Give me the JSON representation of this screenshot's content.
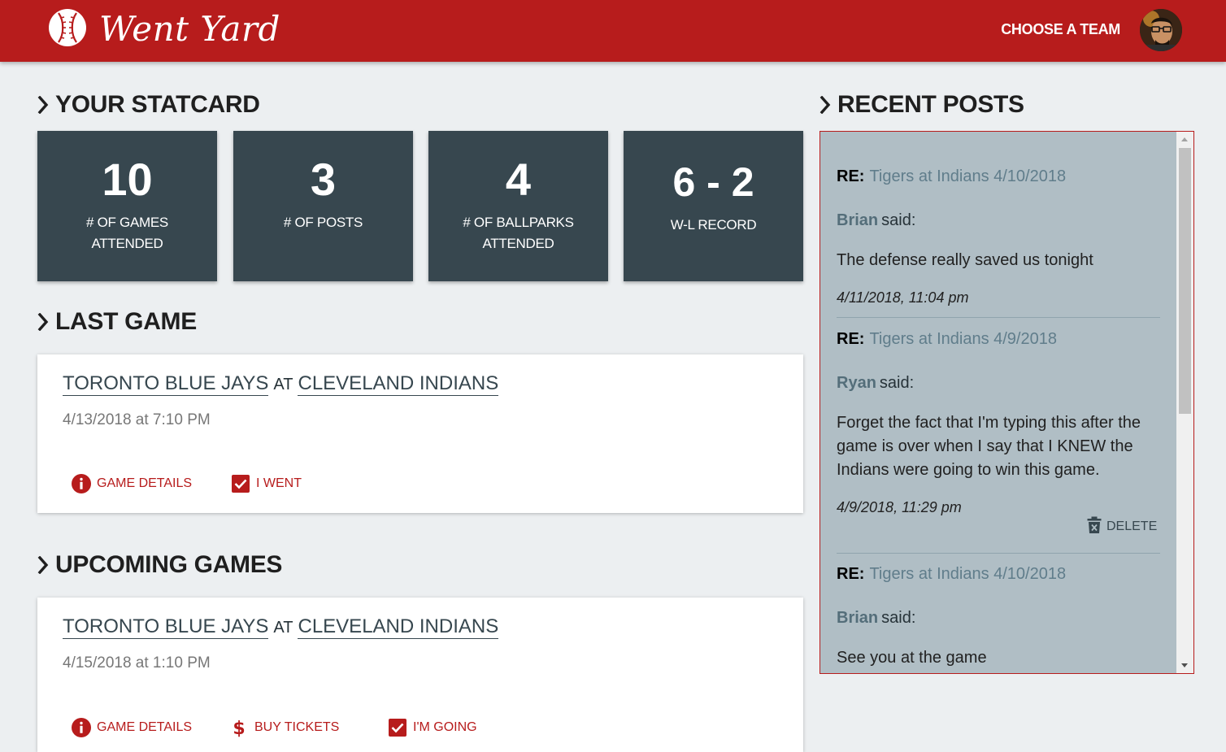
{
  "header": {
    "brand": "Went Yard",
    "nav_choose_team": "CHOOSE A TEAM",
    "brand_color": "#b71c1c"
  },
  "sections": {
    "statcard": "YOUR STATCARD",
    "last_game": "LAST GAME",
    "upcoming_games": "UPCOMING GAMES",
    "recent_posts": "RECENT POSTS"
  },
  "stats": [
    {
      "value": "10",
      "label_line1": "# OF GAMES",
      "label_line2": "ATTENDED"
    },
    {
      "value": "3",
      "label_line1": "# OF POSTS",
      "label_line2": ""
    },
    {
      "value": "4",
      "label_line1": "# OF BALLPARKS",
      "label_line2": "ATTENDED"
    },
    {
      "value": "6 - 2",
      "label_line1": "W-L RECORD",
      "label_line2": ""
    }
  ],
  "last_game": {
    "away_team": "TORONTO BLUE JAYS",
    "at": "AT",
    "home_team": "CLEVELAND INDIANS",
    "datetime": "4/13/2018 at 7:10 PM",
    "actions": {
      "details": "GAME DETAILS",
      "went": "I WENT"
    }
  },
  "upcoming_game": {
    "away_team": "TORONTO BLUE JAYS",
    "at": "AT",
    "home_team": "CLEVELAND INDIANS",
    "datetime": "4/15/2018 at 1:10 PM",
    "actions": {
      "details": "GAME DETAILS",
      "tickets": "BUY TICKETS",
      "going": "I'M GOING"
    }
  },
  "posts": [
    {
      "re_label": "RE:",
      "title": "Tigers at Indians 4/10/2018",
      "author": "Brian",
      "said": "said:",
      "body": "The defense really saved us tonight",
      "date": "4/11/2018, 11:04 pm"
    },
    {
      "re_label": "RE:",
      "title": "Tigers at Indians 4/9/2018",
      "author": "Ryan",
      "said": "said:",
      "body": "Forget the fact that I'm typing this after the game is over when I say that I KNEW the Indians were going to win this game.",
      "date": "4/9/2018, 11:29 pm",
      "delete_label": "DELETE"
    },
    {
      "re_label": "RE:",
      "title": "Tigers at Indians 4/10/2018",
      "author": "Brian",
      "said": "said:",
      "body": "See you at the game"
    }
  ]
}
